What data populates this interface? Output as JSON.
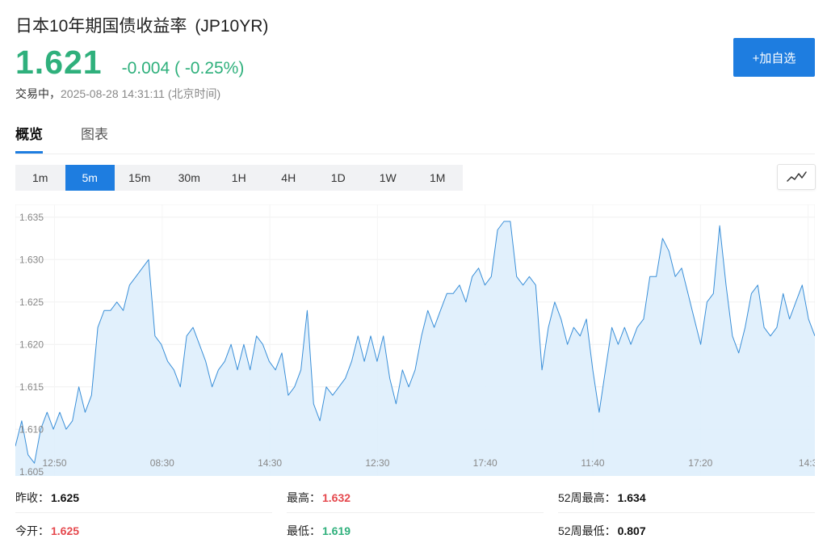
{
  "header": {
    "title": "日本10年期国债收益率",
    "code": "(JP10YR)",
    "price": "1.621",
    "change": "-0.004 ( -0.25%)",
    "status": "交易中，",
    "time": "2025-08-28 14:31:11 (北京时间)",
    "add_button": "+加自选"
  },
  "tabs": [
    {
      "label": "概览",
      "active": true
    },
    {
      "label": "图表",
      "active": false
    }
  ],
  "periods": [
    {
      "label": "1m",
      "active": false
    },
    {
      "label": "5m",
      "active": true
    },
    {
      "label": "15m",
      "active": false
    },
    {
      "label": "30m",
      "active": false
    },
    {
      "label": "1H",
      "active": false
    },
    {
      "label": "4H",
      "active": false
    },
    {
      "label": "1D",
      "active": false
    },
    {
      "label": "1W",
      "active": false
    },
    {
      "label": "1M",
      "active": false
    }
  ],
  "chart_type_icon": "line-chart-icon",
  "colors": {
    "accent": "#1e7de0",
    "up": "#e5484d",
    "down": "#2fb07c",
    "line": "#3a8fd8",
    "fill": "#deeefc"
  },
  "chart_data": {
    "type": "area",
    "y_ticks": [
      "1.635",
      "1.630",
      "1.625",
      "1.620",
      "1.615",
      "1.610",
      "1.605"
    ],
    "x_ticks": [
      "12:50",
      "08:30",
      "14:30",
      "12:30",
      "17:40",
      "11:40",
      "17:20",
      "14:3"
    ],
    "ylim": [
      1.6045,
      1.6365
    ],
    "grid": true,
    "values": [
      1.608,
      1.611,
      1.607,
      1.606,
      1.61,
      1.612,
      1.61,
      1.612,
      1.61,
      1.611,
      1.615,
      1.612,
      1.614,
      1.622,
      1.624,
      1.624,
      1.625,
      1.624,
      1.627,
      1.628,
      1.629,
      1.63,
      1.621,
      1.62,
      1.618,
      1.617,
      1.615,
      1.621,
      1.622,
      1.62,
      1.618,
      1.615,
      1.617,
      1.618,
      1.62,
      1.617,
      1.62,
      1.617,
      1.621,
      1.62,
      1.618,
      1.617,
      1.619,
      1.614,
      1.615,
      1.617,
      1.624,
      1.613,
      1.611,
      1.615,
      1.614,
      1.615,
      1.616,
      1.618,
      1.621,
      1.618,
      1.621,
      1.618,
      1.621,
      1.616,
      1.613,
      1.617,
      1.615,
      1.617,
      1.621,
      1.624,
      1.622,
      1.624,
      1.626,
      1.626,
      1.627,
      1.625,
      1.628,
      1.629,
      1.627,
      1.628,
      1.6335,
      1.6345,
      1.6345,
      1.628,
      1.627,
      1.628,
      1.627,
      1.617,
      1.622,
      1.625,
      1.623,
      1.62,
      1.622,
      1.621,
      1.623,
      1.617,
      1.612,
      1.617,
      1.622,
      1.62,
      1.622,
      1.62,
      1.622,
      1.623,
      1.628,
      1.628,
      1.6325,
      1.631,
      1.628,
      1.629,
      1.626,
      1.623,
      1.62,
      1.625,
      1.626,
      1.634,
      1.627,
      1.621,
      1.619,
      1.622,
      1.626,
      1.627,
      1.622,
      1.621,
      1.622,
      1.626,
      1.623,
      1.625,
      1.627,
      1.623,
      1.621
    ]
  },
  "stats": {
    "prev_close_label": "昨收：",
    "prev_close": "1.625",
    "high_label": "最高：",
    "high": "1.632",
    "week52_high_label": "52周最高：",
    "week52_high": "1.634",
    "open_label": "今开：",
    "open": "1.625",
    "low_label": "最低：",
    "low": "1.619",
    "week52_low_label": "52周最低：",
    "week52_low": "0.807"
  }
}
